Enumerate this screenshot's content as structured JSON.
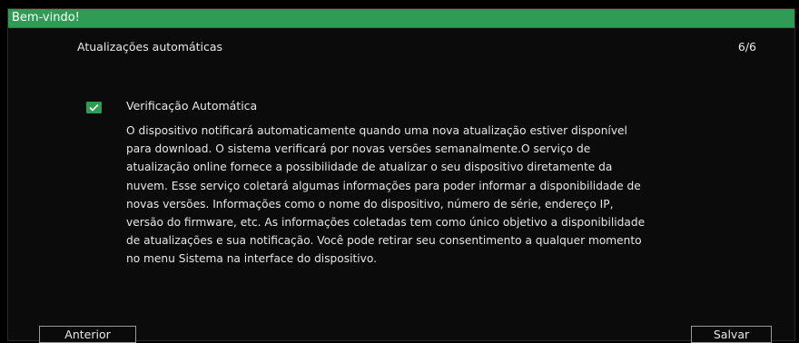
{
  "window": {
    "title": "Bem-vindo!"
  },
  "header": {
    "title": "Atualizações automáticas",
    "step": "6/6"
  },
  "auto_check": {
    "label": "Verificação Automática",
    "checked": true,
    "check_color": "#2f9b55"
  },
  "description": "O dispositivo notificará automaticamente quando uma nova atualização estiver disponível\npara download. O sistema verificará por novas versões semanalmente.O serviço de\natualização online fornece a possibilidade de atualizar o seu dispositivo diretamente da\nnuvem. Esse serviço coletará algumas informações para poder informar a disponibilidade de\nnovas versões. Informações como o nome do dispositivo, número de série, endereço IP,\nversão do firmware, etc. As informações coletadas tem como único objetivo a disponibilidade\n de atualizações e sua notificação. Você pode retirar seu consentimento a qualquer momento\nno menu Sistema na interface do dispositivo.",
  "buttons": {
    "previous": "Anterior",
    "save": "Salvar"
  },
  "colors": {
    "titlebar": "#2f9b55",
    "background": "#0b0b0b",
    "text": "#e8e8e8"
  }
}
